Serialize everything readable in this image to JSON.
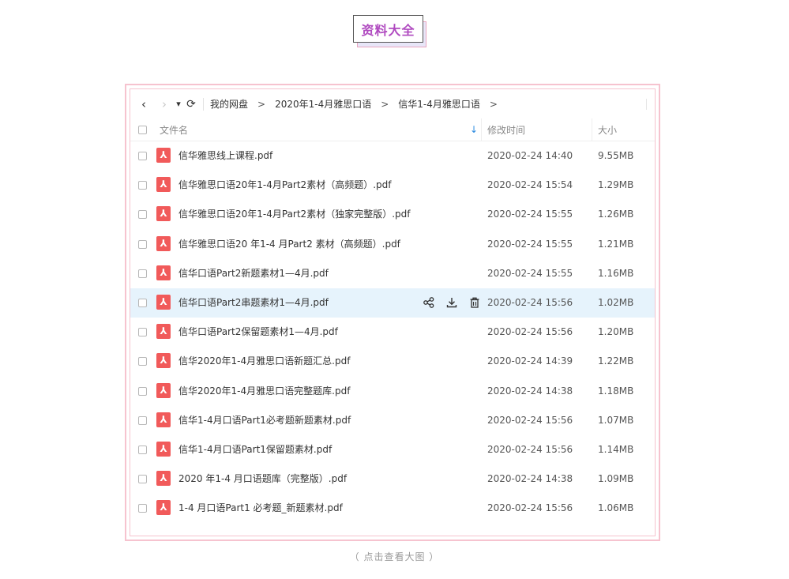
{
  "title_badge": "资料大全",
  "toolbar": {
    "back_icon": "‹",
    "forward_icon": "›",
    "dropdown_icon": "▾",
    "refresh_icon": "⟳",
    "breadcrumb": [
      "我的网盘",
      "2020年1-4月雅思口语",
      "信华1-4月雅思口语"
    ],
    "arrow": ">"
  },
  "header": {
    "name": "文件名",
    "sort_icon": "↓",
    "time": "修改时间",
    "size": "大小"
  },
  "files": [
    {
      "name": "信华雅思线上课程.pdf",
      "time": "2020-02-24 14:40",
      "size": "9.55MB"
    },
    {
      "name": "信华雅思口语20年1-4月Part2素材（高频题）.pdf",
      "time": "2020-02-24 15:54",
      "size": "1.29MB"
    },
    {
      "name": "信华雅思口语20年1-4月Part2素材（独家完整版）.pdf",
      "time": "2020-02-24 15:55",
      "size": "1.26MB"
    },
    {
      "name": "信华雅思口语20 年1-4 月Part2 素材（高频题）.pdf",
      "time": "2020-02-24 15:55",
      "size": "1.21MB"
    },
    {
      "name": "信华口语Part2新题素材1—4月.pdf",
      "time": "2020-02-24 15:55",
      "size": "1.16MB"
    },
    {
      "name": "信华口语Part2串题素材1—4月.pdf",
      "time": "2020-02-24 15:56",
      "size": "1.02MB"
    },
    {
      "name": "信华口语Part2保留题素材1—4月.pdf",
      "time": "2020-02-24 15:56",
      "size": "1.20MB"
    },
    {
      "name": "信华2020年1-4月雅思口语新题汇总.pdf",
      "time": "2020-02-24 14:39",
      "size": "1.22MB"
    },
    {
      "name": "信华2020年1-4月雅思口语完整题库.pdf",
      "time": "2020-02-24 14:38",
      "size": "1.18MB"
    },
    {
      "name": "信华1-4月口语Part1必考题新题素材.pdf",
      "time": "2020-02-24 15:56",
      "size": "1.07MB"
    },
    {
      "name": "信华1-4月口语Part1保留题素材.pdf",
      "time": "2020-02-24 15:56",
      "size": "1.14MB"
    },
    {
      "name": "2020 年1-4 月口语题库（完整版）.pdf",
      "time": "2020-02-24 14:38",
      "size": "1.09MB"
    },
    {
      "name": "1-4 月口语Part1 必考题_新题素材.pdf",
      "time": "2020-02-24 15:56",
      "size": "1.06MB"
    }
  ],
  "highlighted_row": 5,
  "row_action_icons": [
    "share-icon",
    "download-icon",
    "delete-icon"
  ],
  "caption": "（ 点击查看大图 ）",
  "colors": {
    "accent_title": "#b04ac0",
    "pdf_icon": "#f15a5a",
    "frame": "#f6c3cf",
    "highlight": "#e6f3fc",
    "sort_icon": "#2a8ae0"
  }
}
